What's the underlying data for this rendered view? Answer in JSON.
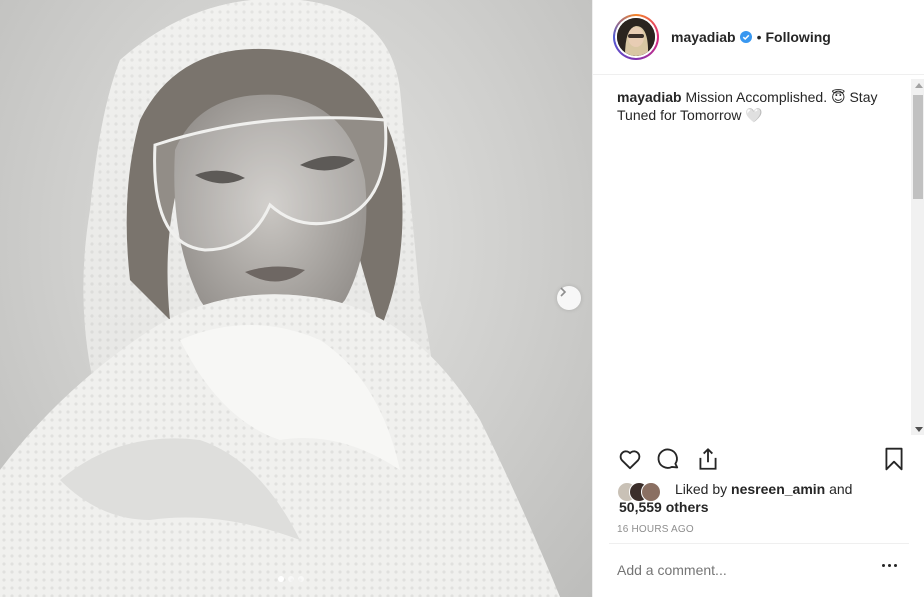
{
  "post": {
    "username": "mayadiab",
    "follow_status": "Following",
    "separator": "•",
    "verified": true
  },
  "caption": {
    "username": "mayadiab",
    "text": "Mission Accomplished. 😇 Stay Tuned for Tomorrow 🤍"
  },
  "likes": {
    "prefix": "Liked by",
    "liked_by_user": "nesreen_amin",
    "joiner": "and",
    "others": "50,559 others"
  },
  "timestamp": "16 HOURS AGO",
  "comment": {
    "placeholder": "Add a comment..."
  },
  "carousel": {
    "current_slide": 1,
    "total_slides": 3
  },
  "icons": {
    "like": "heart-icon",
    "comment": "comment-bubble-icon",
    "share": "share-icon",
    "save": "bookmark-icon",
    "verified": "verified-badge-icon",
    "next": "chevron-right-icon",
    "more": "more-options-icon"
  },
  "colors": {
    "verified_blue": "#3897f0",
    "text": "#262626",
    "muted": "#8e8e8e",
    "border": "#efefef"
  }
}
